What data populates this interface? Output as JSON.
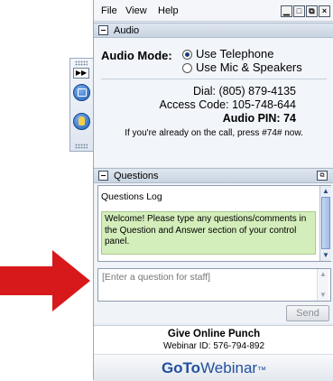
{
  "menu": {
    "file": "File",
    "view": "View",
    "help": "Help"
  },
  "window_controls": {
    "minimize": "▁",
    "maximize": "□",
    "restore": "⧉",
    "close": "×"
  },
  "audio": {
    "section_title": "Audio",
    "mode_label": "Audio Mode:",
    "option_telephone": "Use Telephone",
    "option_mic": "Use Mic & Speakers",
    "selected": "telephone",
    "dial_label": "Dial:",
    "dial_value": "(805) 879-4135",
    "access_label": "Access Code:",
    "access_value": "105-748-644",
    "pin_label": "Audio PIN:",
    "pin_value": "74",
    "call_note": "If you're already on the call, press #74# now."
  },
  "questions": {
    "section_title": "Questions",
    "log_title": "Questions Log",
    "welcome": "Welcome! Please type any questions/comments in the Question and Answer section of your control panel.",
    "input_placeholder": "[Enter a question for staff]",
    "send_label": "Send"
  },
  "webinar": {
    "title": "Give Online Punch",
    "id_line": "Webinar ID: 576-794-892",
    "logo_bold": "GoTo",
    "logo_rest": "Webinar",
    "logo_tm": "™"
  },
  "colors": {
    "arrow": "#d7191c",
    "logo_blue": "#234f9c",
    "welcome_bg": "#d4eebb"
  },
  "icons": [
    "expand-icon",
    "screen-share-icon",
    "raise-hand-icon",
    "popout-icon",
    "collapse-icon"
  ]
}
